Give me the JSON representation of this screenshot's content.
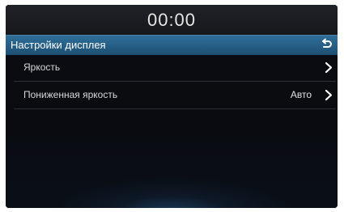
{
  "status_bar": {
    "clock": "00:00"
  },
  "header": {
    "title": "Настройки дисплея",
    "back_icon": "back-arrow-icon"
  },
  "menu": {
    "items": [
      {
        "label": "Яркость",
        "value": "",
        "icon": "chevron-right-icon"
      },
      {
        "label": "Пониженная яркость",
        "value": "Авто",
        "icon": "chevron-right-icon"
      }
    ]
  },
  "colors": {
    "header_accent": "#2f6f9a",
    "background": "#080b10",
    "text": "#e6e6e6"
  }
}
